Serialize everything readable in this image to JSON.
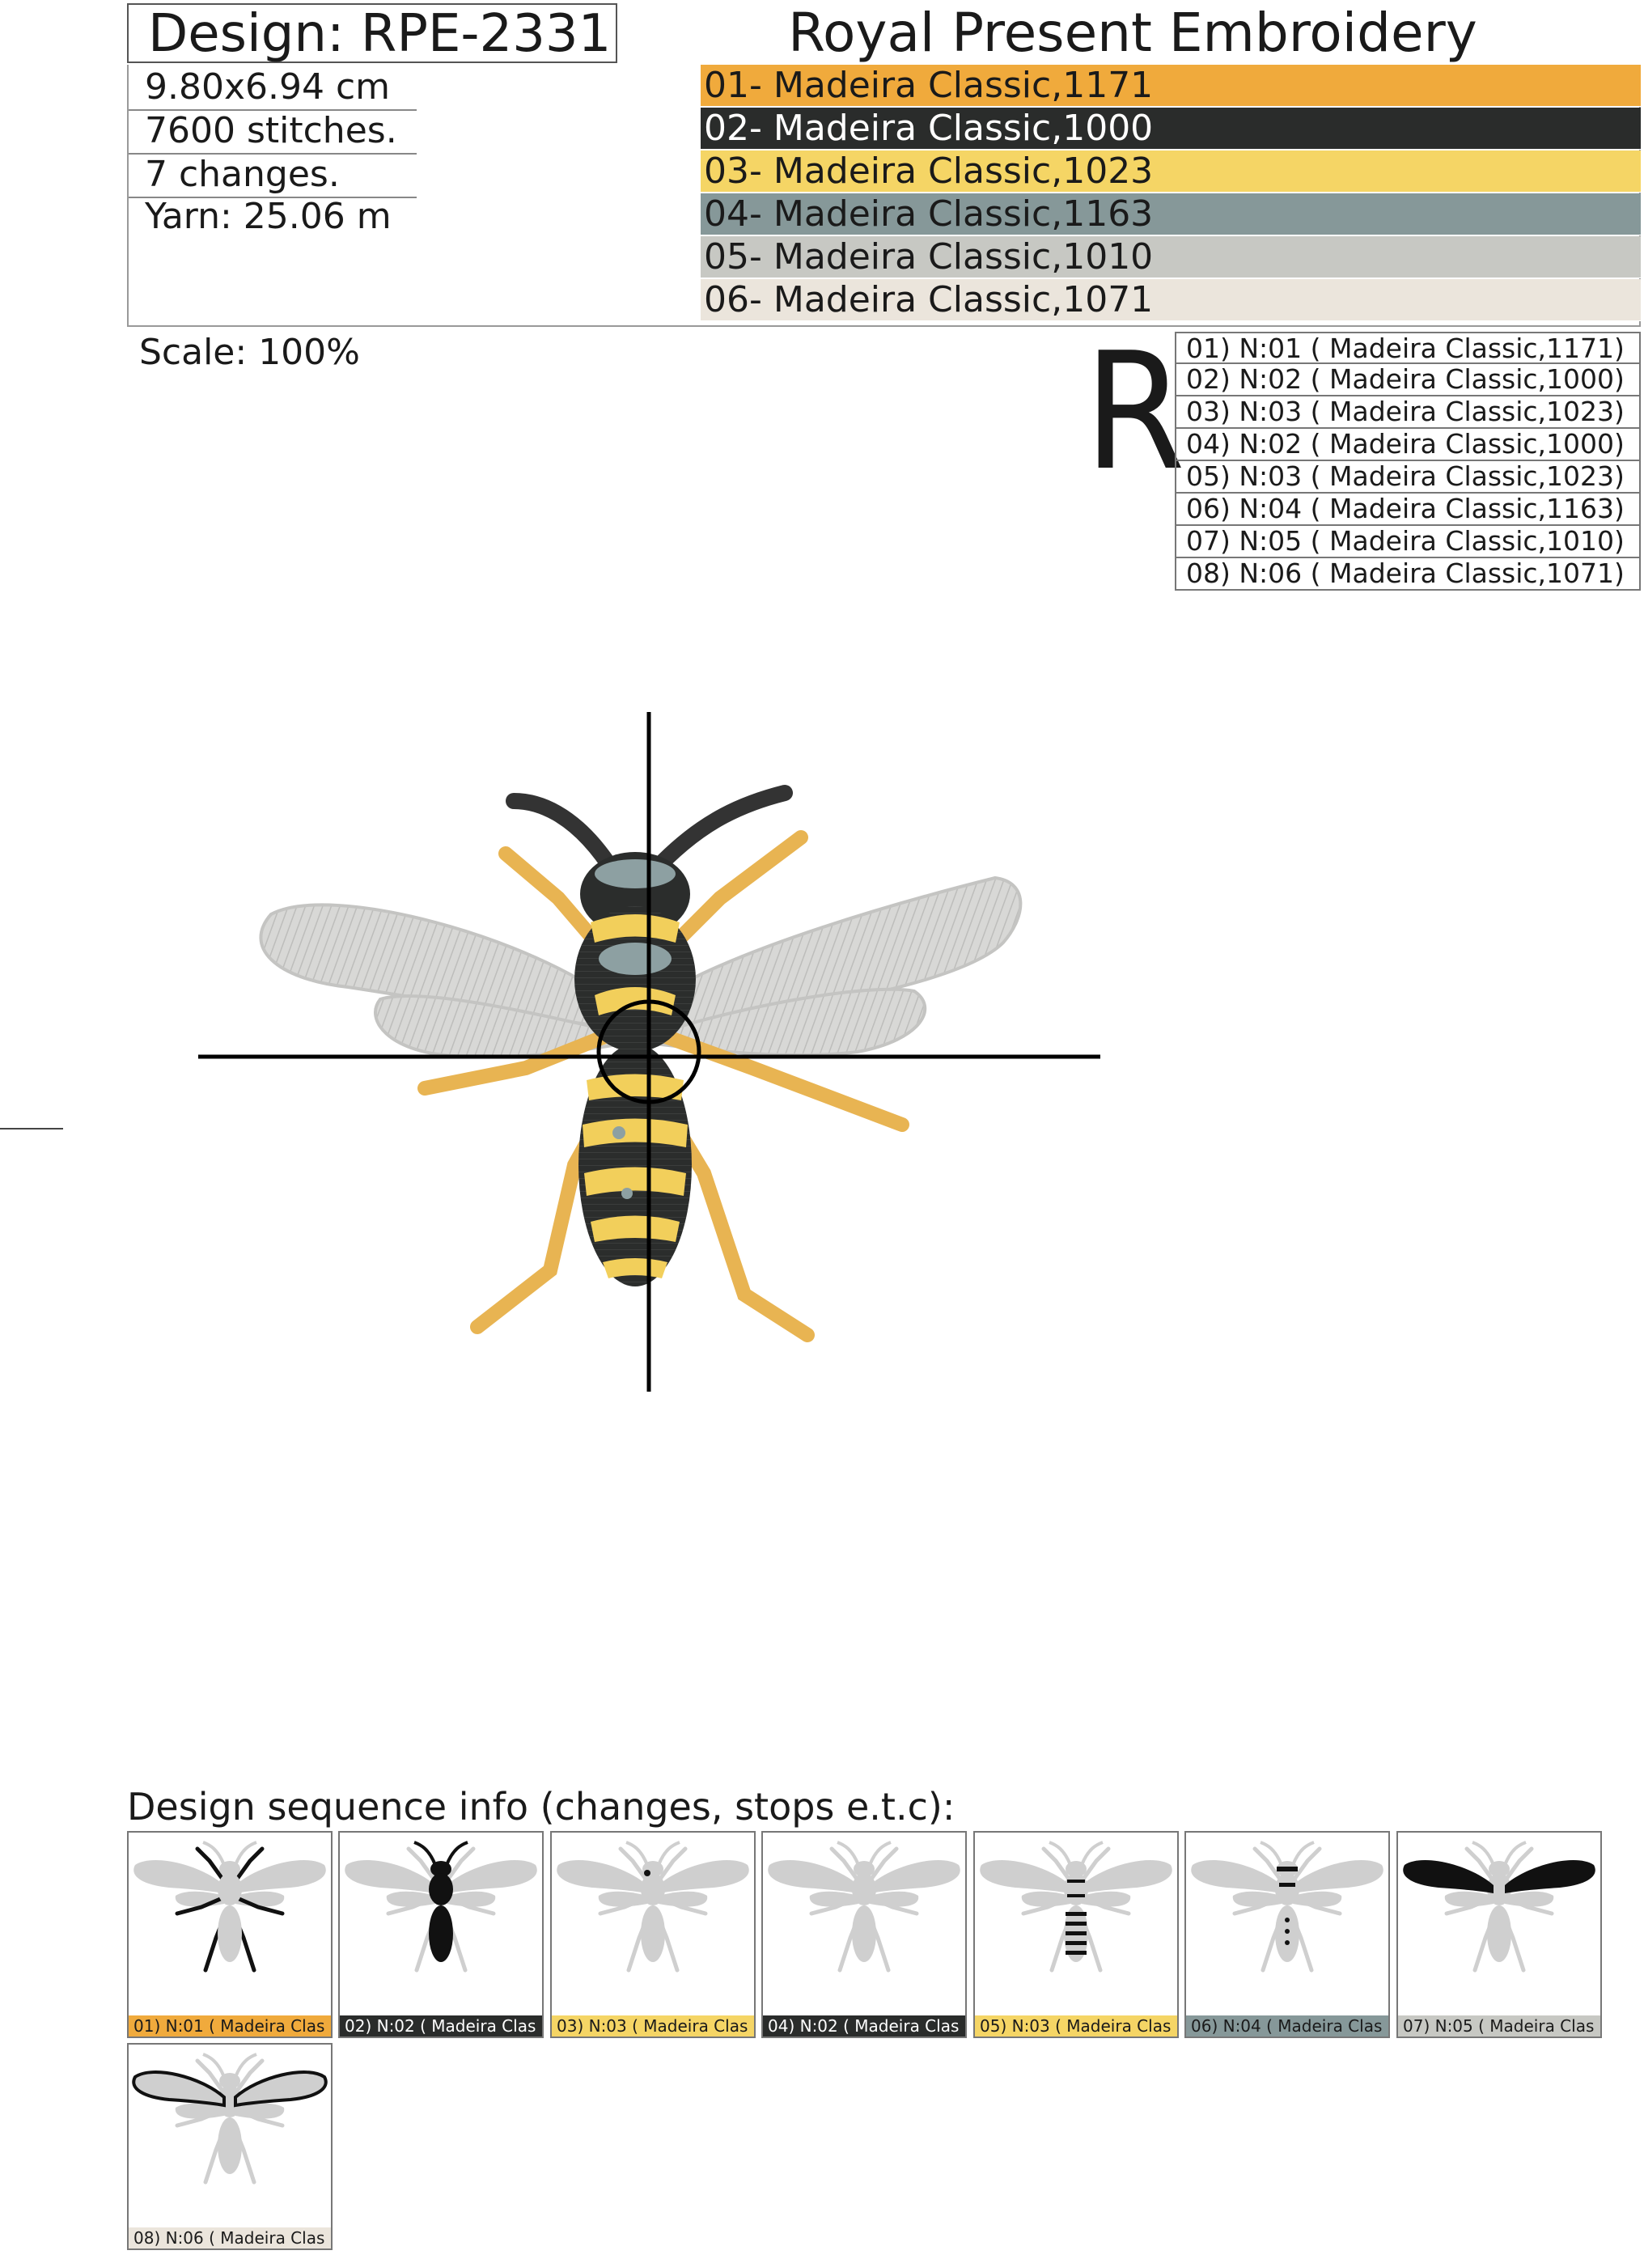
{
  "header": {
    "design": "Design: RPE-2331",
    "brand": "Royal Present Embroidery"
  },
  "specs": {
    "size": "9.80x6.94 cm",
    "stitches": "7600 stitches.",
    "changes": "7 changes.",
    "yarn": "Yarn: 25.06 m"
  },
  "palette": [
    {
      "label": "01- Madeira Classic,1171",
      "color": "#F0AA3C",
      "text_color": "#1a1a1a"
    },
    {
      "label": "02- Madeira Classic,1000",
      "color": "#2A2C2B",
      "text_color": "#ffffff"
    },
    {
      "label": "03- Madeira Classic,1023",
      "color": "#F5D565",
      "text_color": "#1a1a1a"
    },
    {
      "label": "04- Madeira Classic,1163",
      "color": "#869899",
      "text_color": "#1a1a1a"
    },
    {
      "label": "05- Madeira Classic,1010",
      "color": "#C7C8C3",
      "text_color": "#1a1a1a"
    },
    {
      "label": "06- Madeira Classic,1071",
      "color": "#EBE5DC",
      "text_color": "#1a1a1a"
    }
  ],
  "scale": "Scale: 100%",
  "logo_letter": "R",
  "sequence": [
    "01) N:01 ( Madeira Classic,1171)",
    "02) N:02 ( Madeira Classic,1000)",
    "03) N:03 ( Madeira Classic,1023)",
    "04) N:02 ( Madeira Classic,1000)",
    "05) N:03 ( Madeira Classic,1023)",
    "06) N:04 ( Madeira Classic,1163)",
    "07) N:05 ( Madeira Classic,1010)",
    "08) N:06 ( Madeira Classic,1071)"
  ],
  "sequence_header": "Design sequence info (changes, stops e.t.c):",
  "thumbnails": [
    {
      "caption": "01) N:01 ( Madeira Clas",
      "color": "#F0AA3C",
      "text_color": "#1a1a1a",
      "highlight": "legs"
    },
    {
      "caption": "02) N:02 ( Madeira Clas",
      "color": "#2A2C2B",
      "text_color": "#ffffff",
      "highlight": "body"
    },
    {
      "caption": "03) N:03 ( Madeira Clas",
      "color": "#F5D565",
      "text_color": "#1a1a1a",
      "highlight": "spot"
    },
    {
      "caption": "04) N:02 ( Madeira Clas",
      "color": "#2A2C2B",
      "text_color": "#ffffff",
      "highlight": "none"
    },
    {
      "caption": "05) N:03 ( Madeira Clas",
      "color": "#F5D565",
      "text_color": "#1a1a1a",
      "highlight": "stripes"
    },
    {
      "caption": "06) N:04 ( Madeira Clas",
      "color": "#869899",
      "text_color": "#1a1a1a",
      "highlight": "dots"
    },
    {
      "caption": "07) N:05 ( Madeira Clas",
      "color": "#C7C8C3",
      "text_color": "#1a1a1a",
      "highlight": "wings"
    },
    {
      "caption": "08) N:06 ( Madeira Clas",
      "color": "#EBE5DC",
      "text_color": "#1a1a1a",
      "highlight": "outline"
    }
  ]
}
